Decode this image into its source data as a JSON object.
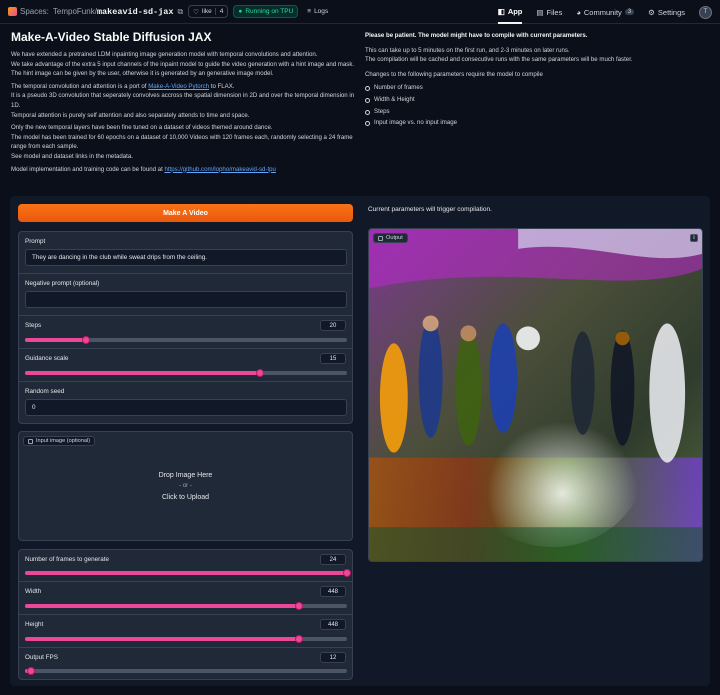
{
  "topbar": {
    "spaces_label": "Spaces:",
    "owner": "TempoFunk/",
    "repo": "makeavid-sd-jax",
    "like_label": "like",
    "like_count": "4",
    "status": "Running on TPU",
    "logs_label": "Logs",
    "tabs": [
      {
        "label": "App",
        "badge": ""
      },
      {
        "label": "Files",
        "badge": ""
      },
      {
        "label": "Community",
        "badge": "3"
      },
      {
        "label": "Settings",
        "badge": ""
      }
    ],
    "avatar_label": "T"
  },
  "intro": {
    "title": "Make-A-Video Stable Diffusion JAX",
    "p1a": "We have extended a pretrained LDM inpainting image generation model with temporal convolutions and attention.",
    "p1b": "We take advantage of the extra 5 input channels of the inpaint model to guide the video generation with a hint image and mask.",
    "p1c": "The hint image can be given by the user, otherwise it is generated by an generative image model.",
    "p2a_pre": "The temporal convolution and attention is a port of ",
    "p2a_link": "Make-A-Video Pytorch",
    "p2a_post": " to FLAX.",
    "p2b": "It is a pseudo 3D convolution that seperately convolves accross the spatial dimension in 2D and over the temporal dimension in 1D.",
    "p2c": "Temporal attention is purely self attention and also separately attends to time and space.",
    "p3a": "Only the new temporal layers have been fine tuned on a dataset of videos themed around dance.",
    "p3b": "The model has been trained for 60 epochs on a dataset of 10,000 Videos with 120 frames each, randomly selecting a 24 frame range from each sample.",
    "p3c": "See model and dataset links in the metadata.",
    "p4_pre": "Model implementation and training code can be found at ",
    "p4_link": "https://github.com/lopho/makeavid-sd-tpu",
    "r1": "Please be patient. The model might have to compile with current parameters.",
    "r2a": "This can take up to 5 minutes on the first run, and 2-3 minutes on later runs.",
    "r2b": "The compilation will be cached and consecutive runs with the same parameters will be much faster.",
    "r3": "Changes to the following parameters require the model to compile",
    "list": [
      "Number of frames",
      "Width & Height",
      "Steps",
      "Input image vs. no input image"
    ]
  },
  "controls": {
    "make_button": "Make A Video",
    "status_text": "Current parameters will trigger compilation.",
    "prompt_label": "Prompt",
    "prompt_value": "They are dancing in the club while sweat drips from the ceiling.",
    "neg_label": "Negative prompt (optional)",
    "neg_value": "",
    "steps_label": "Steps",
    "steps_value": "20",
    "steps_frac": 0.19,
    "guidance_label": "Guidance scale",
    "guidance_value": "15",
    "guidance_frac": 0.73,
    "seed_label": "Random seed",
    "seed_value": "0",
    "input_image_label": "Input image (optional)",
    "drop_text": "Drop Image Here",
    "or_text": "- or -",
    "click_text": "Click to Upload",
    "frames_label": "Number of frames to generate",
    "frames_value": "24",
    "frames_frac": 1.0,
    "width_label": "Width",
    "width_value": "448",
    "width_frac": 0.85,
    "height_label": "Height",
    "height_value": "448",
    "height_frac": 0.85,
    "fps_label": "Output FPS",
    "fps_value": "12",
    "fps_frac": 0.02,
    "output_label": "Output"
  },
  "colors": {
    "accent": "#ea580c",
    "slider": "#ec4899",
    "background": "#0b0f19",
    "panel": "#1f2937"
  },
  "icons": [
    "spaces-logo-icon",
    "copy-icon",
    "heart-icon",
    "logs-icon",
    "app-icon",
    "files-icon",
    "community-icon",
    "settings-icon",
    "image-icon",
    "download-icon"
  ]
}
